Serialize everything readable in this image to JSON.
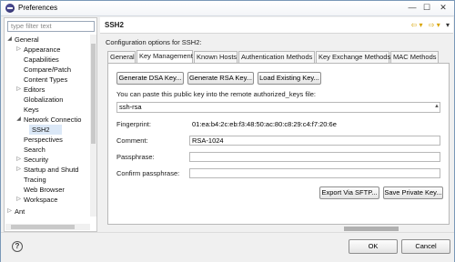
{
  "window": {
    "title": "Preferences",
    "controls": {
      "minimize": "—",
      "maximize": "☐",
      "close": "✕"
    }
  },
  "sidebar": {
    "filter_placeholder": "type filter text",
    "items": [
      {
        "label": "General",
        "expander": "◢"
      },
      {
        "label": "Appearance",
        "expander": "▷"
      },
      {
        "label": "Capabilities",
        "expander": ""
      },
      {
        "label": "Compare/Patch",
        "expander": ""
      },
      {
        "label": "Content Types",
        "expander": ""
      },
      {
        "label": "Editors",
        "expander": "▷"
      },
      {
        "label": "Globalization",
        "expander": ""
      },
      {
        "label": "Keys",
        "expander": ""
      },
      {
        "label": "Network Connectio",
        "expander": "◢"
      },
      {
        "label": "SSH2",
        "expander": ""
      },
      {
        "label": "Perspectives",
        "expander": ""
      },
      {
        "label": "Search",
        "expander": ""
      },
      {
        "label": "Security",
        "expander": "▷"
      },
      {
        "label": "Startup and Shutd",
        "expander": "▷"
      },
      {
        "label": "Tracing",
        "expander": ""
      },
      {
        "label": "Web Browser",
        "expander": ""
      },
      {
        "label": "Workspace",
        "expander": "▷"
      },
      {
        "label": "Ant",
        "expander": "▷"
      }
    ]
  },
  "main": {
    "title": "SSH2",
    "nav": {
      "back": "⇦ ▾",
      "forward": "⇨ ▾",
      "menu": "▾"
    },
    "config_label": "Configuration options for SSH2:",
    "tabs": [
      "General",
      "Key Management",
      "Known Hosts",
      "Authentication Methods",
      "Key Exchange Methods",
      "MAC Methods"
    ],
    "key_buttons": {
      "generate_dsa": "Generate DSA Key...",
      "generate_rsa": "Generate RSA Key...",
      "load_existing": "Load Existing Key..."
    },
    "paste_hint": "You can paste this public key into the remote authorized_keys file:",
    "public_key": "ssh-rsa",
    "fingerprint_label": "Fingerprint:",
    "fingerprint_value": "01:ea:b4:2c:eb:f3:48:50:ac:80:c8:29:c4:f7:20:6e",
    "comment_label": "Comment:",
    "comment_value": "RSA-1024",
    "passphrase_label": "Passphrase:",
    "passphrase_value": "",
    "confirm_label": "Confirm passphrase:",
    "confirm_value": "",
    "export_button": "Export Via SFTP...",
    "save_button": "Save Private Key..."
  },
  "footer": {
    "help": "?",
    "ok": "OK",
    "cancel": "Cancel"
  }
}
